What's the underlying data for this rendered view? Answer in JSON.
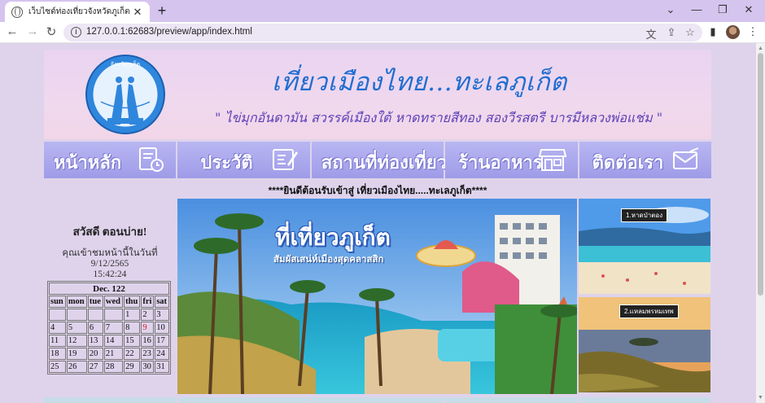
{
  "browser": {
    "tab_title": "เว็บไซต์ท่องเที่ยวจังหวัดภูเก็ต",
    "tab_close": "✕",
    "new_tab": "+",
    "url": "127.0.0.1:62683/preview/app/index.html",
    "controls": {
      "dropdown": "⌄",
      "minimize": "—",
      "maximize": "❐",
      "close": "✕"
    }
  },
  "banner": {
    "title": "เที่ยวเมืองไทย...ทะเลภูเก็ต",
    "motto": "\" ไข่มุกอันดามัน สวรรค์เมืองใต้ หาดทรายสีทอง สองวีรสตรี บารมีหลวงพ่อแช่ม \"",
    "seal_text": "จังหวัดภูเก็ต"
  },
  "menu": {
    "items": [
      {
        "label": "หน้าหลัก",
        "icon": "document-clock-icon"
      },
      {
        "label": "ประวัติ",
        "icon": "notebook-pen-icon"
      },
      {
        "label": "สถานที่ท่องเที่ยว",
        "icon": ""
      },
      {
        "label": "ร้านอาหาร",
        "icon": "storefront-icon"
      },
      {
        "label": "ติดต่อเรา",
        "icon": "envelope-icon"
      }
    ]
  },
  "marquee": {
    "text": "****ยินดีต้อนรับเข้าสู่ เที่ยวเมืองไทย.....ทะเลภูเก็ต****"
  },
  "sidebar": {
    "greeting": "สวัสดี ตอนบ่าย!",
    "visit_text": "คุณเข้าชมหน้านี้ในวันที่ 9/12/2565",
    "visit_time": "15:42:24"
  },
  "calendar": {
    "title": "Dec. 122",
    "days": [
      "sun",
      "mon",
      "tue",
      "wed",
      "thu",
      "fri",
      "sat"
    ],
    "weeks": [
      [
        "",
        "",
        "",
        "",
        "1",
        "2",
        "3"
      ],
      [
        "4",
        "5",
        "6",
        "7",
        "8",
        "9",
        "10"
      ],
      [
        "11",
        "12",
        "13",
        "14",
        "15",
        "16",
        "17"
      ],
      [
        "18",
        "19",
        "20",
        "21",
        "22",
        "23",
        "24"
      ],
      [
        "25",
        "26",
        "27",
        "28",
        "29",
        "30",
        "31"
      ]
    ],
    "today": "9"
  },
  "hero": {
    "title": "ที่เที่ยวภูเก็ต",
    "subtitle": "สัมผัสเสน่ห์เมืองสุดคลาสสิก"
  },
  "thumbnails": [
    {
      "label": "1.หาดป่าตอง"
    },
    {
      "label": "2.แหลมพรหมเทพ"
    }
  ]
}
